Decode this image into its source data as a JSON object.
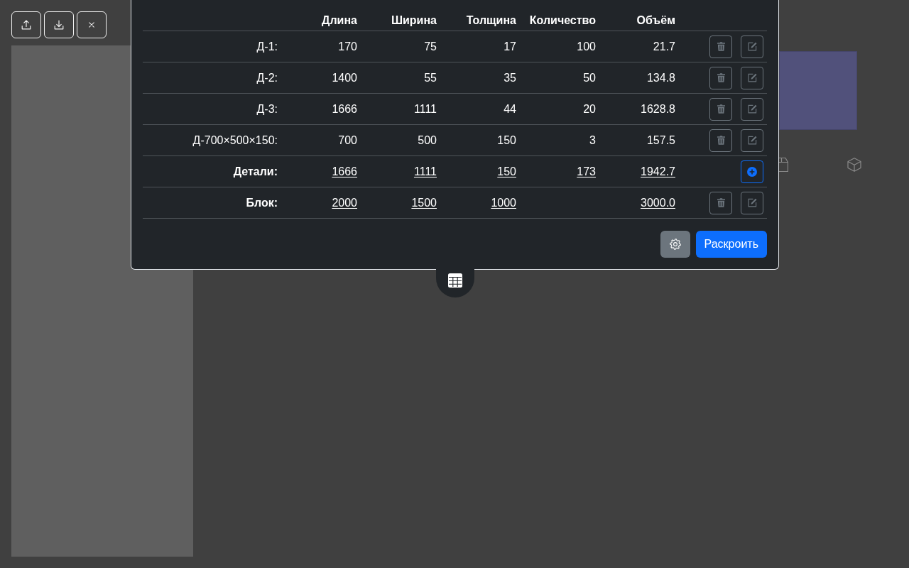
{
  "toolbar": [
    {
      "kind": "upload"
    },
    {
      "kind": "download"
    },
    {
      "kind": "close"
    }
  ],
  "parts_table": {
    "columns": [
      "Длина",
      "Ширина",
      "Толщина",
      "Количество",
      "Объём"
    ],
    "rows": [
      {
        "kind": "part",
        "label": "Д-1:",
        "cells": [
          "170",
          "75",
          "17",
          "100",
          "21.7"
        ],
        "actions": [
          {
            "kind": "delete"
          },
          {
            "kind": "edit"
          }
        ]
      },
      {
        "kind": "part",
        "label": "Д-2:",
        "cells": [
          "1400",
          "55",
          "35",
          "50",
          "134.8"
        ],
        "actions": [
          {
            "kind": "delete"
          },
          {
            "kind": "edit"
          }
        ]
      },
      {
        "kind": "part",
        "label": "Д-3:",
        "cells": [
          "1666",
          "1111",
          "44",
          "20",
          "1628.8"
        ],
        "actions": [
          {
            "kind": "delete"
          },
          {
            "kind": "edit"
          }
        ]
      },
      {
        "kind": "part",
        "label": "Д-700×500×150:",
        "cells": [
          "700",
          "500",
          "150",
          "3",
          "157.5"
        ],
        "actions": [
          {
            "kind": "delete"
          },
          {
            "kind": "edit"
          }
        ]
      },
      {
        "kind": "summary",
        "label": "Детали:",
        "cells": [
          "1666",
          "1111",
          "150",
          "173",
          "1942.7"
        ],
        "actions": [
          {
            "kind": "add"
          }
        ]
      },
      {
        "kind": "summary",
        "label": "Блок:",
        "cells": [
          "2000",
          "1500",
          "1000",
          null,
          "3000.0"
        ],
        "actions": [
          {
            "kind": "delete"
          },
          {
            "kind": "edit"
          }
        ]
      }
    ]
  },
  "dialog_buttons": [
    {
      "kind": "settings"
    },
    {
      "kind": "primary",
      "label": "Раскроить"
    }
  ]
}
